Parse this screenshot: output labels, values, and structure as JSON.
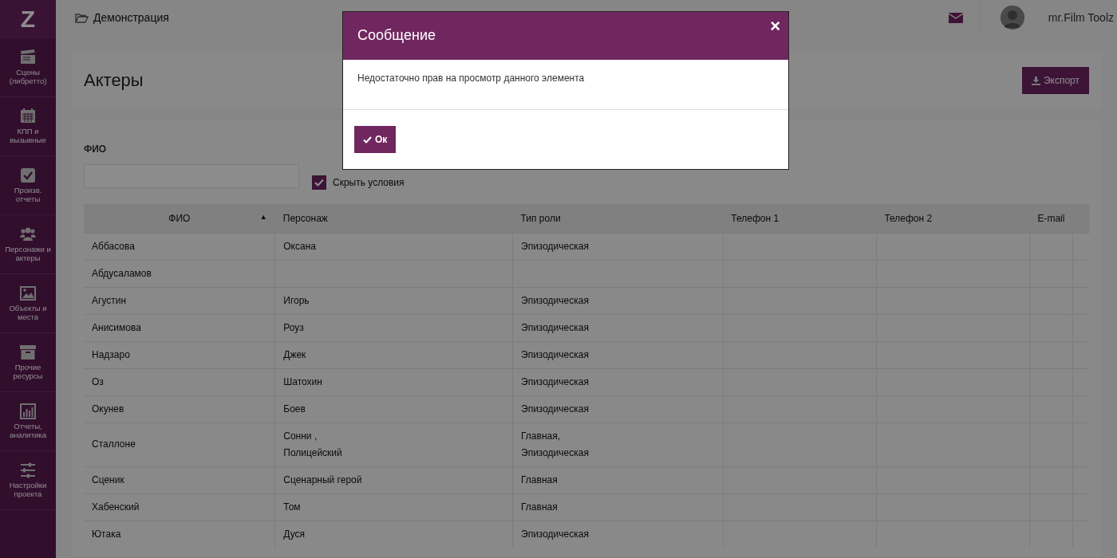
{
  "sidebar": {
    "logo": "Z",
    "items": [
      {
        "label": "Сцены (либретто)"
      },
      {
        "label": "КПП и вызывные"
      },
      {
        "label": "Произв. отчеты"
      },
      {
        "label": "Персонажи и актеры"
      },
      {
        "label": "Объекты и места"
      },
      {
        "label": "Прочие ресурсы"
      },
      {
        "label": "Отчеты, аналитика"
      },
      {
        "label": "Настройки проекта"
      }
    ]
  },
  "topbar": {
    "breadcrumb": "Демонстрация",
    "user": "mr.Film Toolz"
  },
  "page": {
    "title": "Актеры",
    "export_button": "Экспорт"
  },
  "filter": {
    "label": "ФИО",
    "hide_conditions": {
      "label": "Скрыть условия",
      "checked": true
    }
  },
  "table": {
    "columns": [
      {
        "label": "ФИО",
        "sort_mark": "▲"
      },
      {
        "label": "Персонаж"
      },
      {
        "label": "Тип роли"
      },
      {
        "label": "Телефон 1"
      },
      {
        "label": "Телефон 2"
      },
      {
        "label": "E-mail"
      }
    ],
    "rows": [
      {
        "name": "Аббасова",
        "character": [
          "Оксана"
        ],
        "role": [
          "Эпизодическая"
        ]
      },
      {
        "name": "Абдусаламов",
        "character": [],
        "role": []
      },
      {
        "name": "Агустин",
        "character": [
          "Игорь"
        ],
        "role": [
          "Эпизодическая"
        ]
      },
      {
        "name": "Анисимова",
        "character": [
          "Роуз"
        ],
        "role": [
          "Эпизодическая"
        ]
      },
      {
        "name": "Надзаро",
        "character": [
          "Джек"
        ],
        "role": [
          "Эпизодическая"
        ]
      },
      {
        "name": "Оз",
        "character": [
          "Шатохин"
        ],
        "role": [
          "Эпизодическая"
        ]
      },
      {
        "name": "Окунев",
        "character": [
          "Боев"
        ],
        "role": [
          "Эпизодическая"
        ]
      },
      {
        "name": "Сталлоне",
        "character": [
          "Сонни ,",
          "Полицейский"
        ],
        "role": [
          "Главная,",
          "Эпизодическая"
        ]
      },
      {
        "name": "Сценик",
        "character": [
          "Сценарный герой"
        ],
        "role": [
          "Главная"
        ]
      },
      {
        "name": "Хабенский",
        "character": [
          "Том"
        ],
        "role": [
          "Главная"
        ]
      },
      {
        "name": "Ютака",
        "character": [
          "Дуся"
        ],
        "role": [
          "Эпизодическая"
        ]
      }
    ]
  },
  "modal": {
    "title": "Сообщение",
    "close": "×",
    "message": "Недостаточно прав на просмотр данного элемента",
    "ok_button": "Ок"
  }
}
